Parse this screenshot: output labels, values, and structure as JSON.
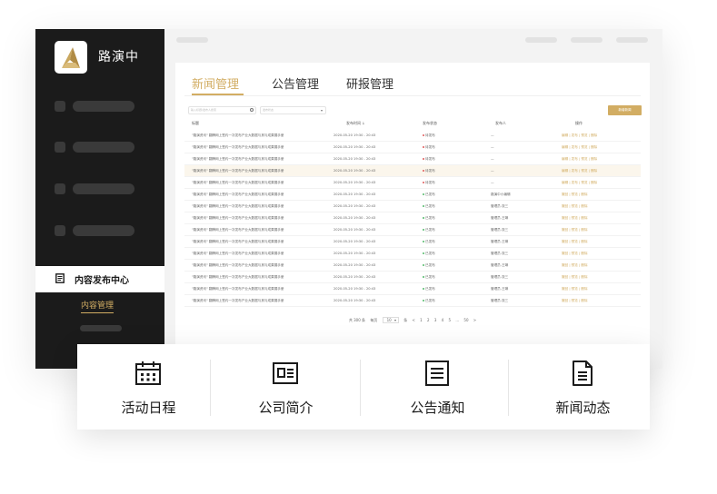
{
  "sidebar": {
    "brand": "路演中",
    "active_nav": "内容发布中心",
    "sub_item": "内容管理"
  },
  "tabs": [
    {
      "label": "新闻管理",
      "active": true
    },
    {
      "label": "公告管理",
      "active": false
    },
    {
      "label": "研报管理",
      "active": false
    }
  ],
  "toolbar": {
    "search_placeholder": "输入标题/发布人搜索",
    "select_placeholder": "发布状态",
    "add_label": "新增新闻"
  },
  "table": {
    "headers": [
      "标题",
      "发布时间 ↓",
      "发布状态",
      "发布人",
      "操作"
    ],
    "rows": [
      {
        "title": "\"路演资讯\" 翻腾网上签约一次发布产业大数据与其与成果展手册",
        "time": "2020-05-20 19:30 - 20:43",
        "status": "待发布",
        "status_kind": "pending",
        "publisher": "—",
        "ops": "编辑 | 发布 | 预览 | 删除"
      },
      {
        "title": "\"路演资讯\" 翻腾网上签约一次发布产业大数据与其与成果展手册",
        "time": "2020-05-20 19:30 - 20:43",
        "status": "待发布",
        "status_kind": "pending",
        "publisher": "—",
        "ops": "编辑 | 发布 | 预览 | 删除"
      },
      {
        "title": "\"路演资讯\" 翻腾网上签约一次发布产业大数据与其与成果展手册",
        "time": "2020-05-20 19:30 - 20:43",
        "status": "待发布",
        "status_kind": "pending",
        "publisher": "—",
        "ops": "编辑 | 发布 | 预览 | 删除"
      },
      {
        "title": "\"路演资讯\" 翻腾网上签约一次发布产业大数据与其与成果展手册",
        "time": "2020-05-20 19:30 - 20:43",
        "status": "待发布",
        "status_kind": "pending",
        "publisher": "—",
        "ops": "编辑 | 发布 | 预览 | 删除",
        "highlight": true
      },
      {
        "title": "\"路演资讯\" 翻腾网上签约一次发布产业大数据与其与成果展手册",
        "time": "2020-05-20 19:30 - 20:43",
        "status": "待发布",
        "status_kind": "pending",
        "publisher": "—",
        "ops": "编辑 | 发布 | 预览 | 删除"
      },
      {
        "title": "\"路演资讯\" 翻腾网上签约一次发布产业大数据与其与成果展手册",
        "time": "2020-05-20 19:30 - 20:43",
        "status": "已发布",
        "status_kind": "published",
        "publisher": "路演中小编辑",
        "ops": "撤回 | 预览 | 删除"
      },
      {
        "title": "\"路演资讯\" 翻腾网上签约一次发布产业大数据与其与成果展手册",
        "time": "2020-05-20 19:30 - 20:43",
        "status": "已发布",
        "status_kind": "published",
        "publisher": "管理员-张三",
        "ops": "撤回 | 预览 | 删除"
      },
      {
        "title": "\"路演资讯\" 翻腾网上签约一次发布产业大数据与其与成果展手册",
        "time": "2020-05-20 19:30 - 20:43",
        "status": "已发布",
        "status_kind": "published",
        "publisher": "管理员-王琳",
        "ops": "撤回 | 预览 | 删除"
      },
      {
        "title": "\"路演资讯\" 翻腾网上签约一次发布产业大数据与其与成果展手册",
        "time": "2020-05-20 19:30 - 20:43",
        "status": "已发布",
        "status_kind": "published",
        "publisher": "管理员-张三",
        "ops": "撤回 | 预览 | 删除"
      },
      {
        "title": "\"路演资讯\" 翻腾网上签约一次发布产业大数据与其与成果展手册",
        "time": "2020-05-20 19:30 - 20:43",
        "status": "已发布",
        "status_kind": "published",
        "publisher": "管理员-王琳",
        "ops": "撤回 | 预览 | 删除"
      },
      {
        "title": "\"路演资讯\" 翻腾网上签约一次发布产业大数据与其与成果展手册",
        "time": "2020-05-20 19:30 - 20:43",
        "status": "已发布",
        "status_kind": "published",
        "publisher": "管理员-张三",
        "ops": "撤回 | 预览 | 删除"
      },
      {
        "title": "\"路演资讯\" 翻腾网上签约一次发布产业大数据与其与成果展手册",
        "time": "2020-05-20 19:30 - 20:43",
        "status": "已发布",
        "status_kind": "published",
        "publisher": "管理员-王琳",
        "ops": "撤回 | 预览 | 删除"
      },
      {
        "title": "\"路演资讯\" 翻腾网上签约一次发布产业大数据与其与成果展手册",
        "time": "2020-05-20 19:30 - 20:43",
        "status": "已发布",
        "status_kind": "published",
        "publisher": "管理员-张三",
        "ops": "撤回 | 预览 | 删除"
      },
      {
        "title": "\"路演资讯\" 翻腾网上签约一次发布产业大数据与其与成果展手册",
        "time": "2020-05-20 19:30 - 20:43",
        "status": "已发布",
        "status_kind": "published",
        "publisher": "管理员-王琳",
        "ops": "撤回 | 预览 | 删除"
      },
      {
        "title": "\"路演资讯\" 翻腾网上签约一次发布产业大数据与其与成果展手册",
        "time": "2020-05-20 19:30 - 20:43",
        "status": "已发布",
        "status_kind": "published",
        "publisher": "管理员-张三",
        "ops": "撤回 | 预览 | 删除"
      }
    ]
  },
  "pagination": {
    "total": "共 300 条",
    "per_page_label": "每页",
    "per_page": "10",
    "per_page_unit": "条",
    "prev": "<",
    "pages": [
      "1",
      "2",
      "3",
      "4",
      "5",
      "...",
      "50"
    ],
    "next": ">"
  },
  "features": [
    {
      "label": "活动日程",
      "icon": "calendar-icon"
    },
    {
      "label": "公司简介",
      "icon": "company-profile-icon"
    },
    {
      "label": "公告通知",
      "icon": "notice-icon"
    },
    {
      "label": "新闻动态",
      "icon": "news-document-icon"
    }
  ],
  "colors": {
    "accent": "#d2ad63",
    "sidebar_bg": "#1b1b1b",
    "pending": "#e05a5a",
    "published": "#52b96a"
  }
}
